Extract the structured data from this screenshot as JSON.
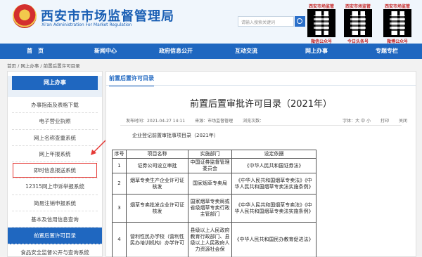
{
  "header": {
    "title": "西安市市场监督管理局",
    "subtitle": "Xi'an Administration For Market Regulation",
    "search_placeholder": "请输入搜索关键词",
    "qr_codes": [
      {
        "title": "西安市场监管",
        "foot": "微信公众号"
      },
      {
        "title": "西安市场监管",
        "foot": "今日头条号"
      },
      {
        "title": "西安市场监管",
        "foot": "微博公众号"
      }
    ]
  },
  "nav": [
    "首　页",
    "新闻中心",
    "政府信息公开",
    "互动交流",
    "网上办事",
    "专题专栏"
  ],
  "breadcrumb": "首页 / 网上办事 / 前置后置许可目录",
  "sidebar": {
    "heading": "网上办事",
    "items": [
      "办事指南及表格下载",
      "电子营业执照",
      "网上名称查重系统",
      "网上年报系统",
      "即时信息报送系统",
      "12315网上申诉举报系统",
      "简易注销申报系统",
      "基本及信用信息查询",
      "前置后置许可目录",
      "食品安全监督公开与查询系统"
    ],
    "active_index": 8,
    "highlight_index": 4
  },
  "main": {
    "tab": "前置后置许可目录",
    "title": "前置后置审批许可目录（2021年）",
    "published": "发布时间：2021-04-27 14:11",
    "source": "来源：市场监督管理",
    "views": "浏览次数：",
    "font_size": "字体：大 中 小",
    "print": "打印",
    "close": "关闭",
    "subtitle": "企业登记前置审批事项目录（2021年）"
  },
  "table": {
    "headers": [
      "序号",
      "项目名称",
      "实施部门",
      "设定依据"
    ],
    "rows": [
      [
        "1",
        "证券公司设立审批",
        "中国证券监督管理委员会",
        "《中华人民共和国证券法》"
      ],
      [
        "2",
        "烟草专卖生产企业许可证核发",
        "国家烟草专卖局",
        "《中华人民共和国烟草专卖法》《中华人民共和国烟草专卖法实施条例》"
      ],
      [
        "3",
        "烟草专卖批发企业许可证核发",
        "国家烟草专卖局或省级烟草专卖行政主管部门",
        "《中华人民共和国烟草专卖法》《中华人民共和国烟草专卖法实施条例》"
      ],
      [
        "4",
        "营利性民办学校（营利性民办培训机构）办学许可",
        "县级以上人民政府教育行政部门、县级以上人民政府人力资源社会保",
        "《中华人民共和国民办教育促进法》"
      ]
    ]
  },
  "colors": {
    "primary": "#1f67c0",
    "highlight": "#e53935",
    "title": "#1a5fb4"
  }
}
